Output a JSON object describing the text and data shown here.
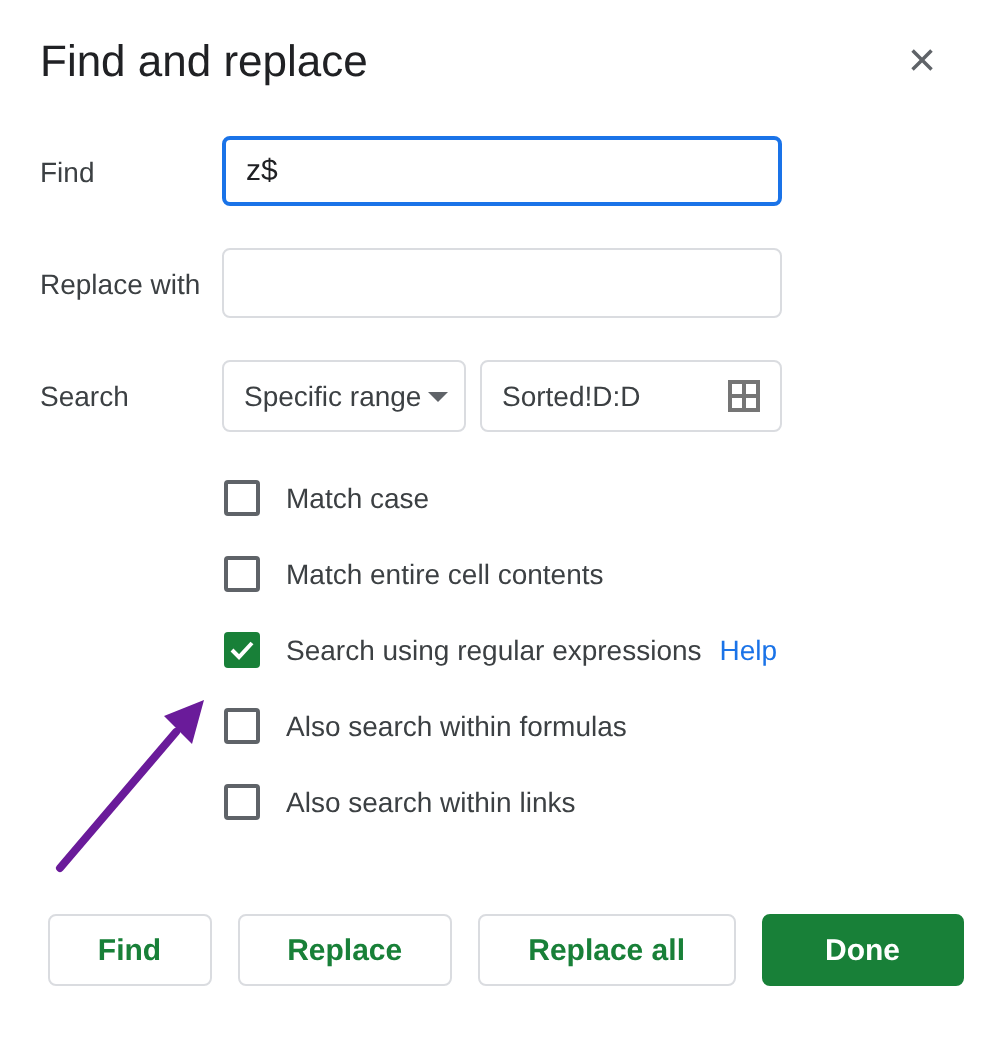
{
  "dialog": {
    "title": "Find and replace",
    "close": "×"
  },
  "find": {
    "label": "Find",
    "value": "z$",
    "focused": true
  },
  "replace": {
    "label": "Replace with"
  },
  "search": {
    "label": "Search",
    "scope": "Specific range",
    "range": "Sorted!D:D"
  },
  "options": [
    {
      "label": "Match case",
      "checked": false
    },
    {
      "label": "Match entire cell contents",
      "checked": false
    },
    {
      "label": "Search using regular expressions",
      "checked": true,
      "link": "Help"
    },
    {
      "label": "Also search within formulas",
      "checked": false
    },
    {
      "label": "Also search within links",
      "checked": false
    }
  ],
  "buttons": [
    {
      "label": "Find",
      "kind": "outlined"
    },
    {
      "label": "Replace",
      "kind": "outlined"
    },
    {
      "label": "Replace all",
      "kind": "outlined"
    },
    {
      "label": "Done",
      "kind": "primary"
    }
  ]
}
